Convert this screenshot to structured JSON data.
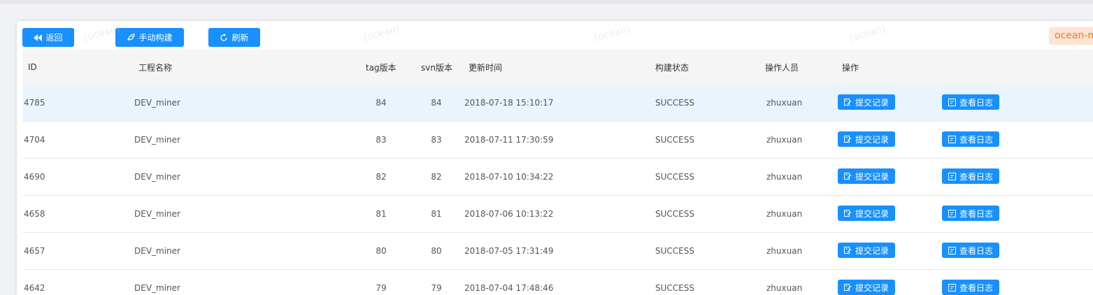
{
  "toolbar": {
    "back_label": "返回",
    "build_label": "手动构建",
    "refresh_label": "刷新",
    "env_tag": "ocean-m"
  },
  "table": {
    "headers": {
      "id": "ID",
      "project": "工程名称",
      "tag": "tag版本",
      "svn": "svn版本",
      "updated": "更新时间",
      "status": "构建状态",
      "operator": "操作人员",
      "actions": "操作"
    },
    "commit_label": "提交记录",
    "log_label": "查看日志",
    "rows": [
      {
        "id": "4785",
        "project": "DEV_miner",
        "tag": "84",
        "svn": "84",
        "updated": "2018-07-18 15:10:17",
        "status": "SUCCESS",
        "operator": "zhuxuan"
      },
      {
        "id": "4704",
        "project": "DEV_miner",
        "tag": "83",
        "svn": "83",
        "updated": "2018-07-11 17:30:59",
        "status": "SUCCESS",
        "operator": "zhuxuan"
      },
      {
        "id": "4690",
        "project": "DEV_miner",
        "tag": "82",
        "svn": "82",
        "updated": "2018-07-10 10:34:22",
        "status": "SUCCESS",
        "operator": "zhuxuan"
      },
      {
        "id": "4658",
        "project": "DEV_miner",
        "tag": "81",
        "svn": "81",
        "updated": "2018-07-06 10:13:22",
        "status": "SUCCESS",
        "operator": "zhuxuan"
      },
      {
        "id": "4657",
        "project": "DEV_miner",
        "tag": "80",
        "svn": "80",
        "updated": "2018-07-05 17:31:49",
        "status": "SUCCESS",
        "operator": "zhuxuan"
      },
      {
        "id": "4642",
        "project": "DEV_miner",
        "tag": "79",
        "svn": "79",
        "updated": "2018-07-04 17:48:46",
        "status": "SUCCESS",
        "operator": "zhuxuan"
      }
    ]
  },
  "colors": {
    "primary": "#1890ff",
    "env_tag_bg": "#fde4d3",
    "env_tag_text": "#f5743c",
    "highlight_row": "#eaf4fc"
  },
  "icons": {
    "back": "backward-icon",
    "build": "rocket-icon",
    "refresh": "refresh-icon",
    "commit": "edit-record-icon",
    "log": "log-icon"
  }
}
